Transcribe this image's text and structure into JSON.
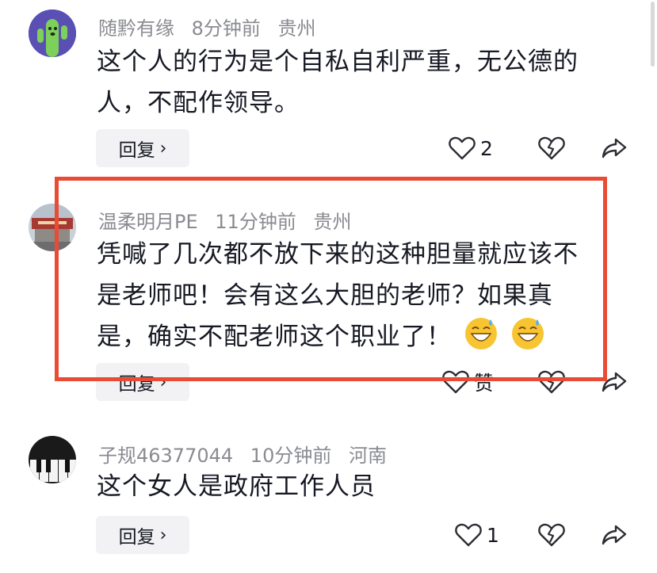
{
  "comments": [
    {
      "username": "随黔有缘",
      "time": "8分钟前",
      "location": "贵州",
      "lines": [
        "这个人的行为是个自私自利严重，无公德的",
        "人，不配作领导。"
      ],
      "reply_label": "回复",
      "like_count": "2"
    },
    {
      "username": "温柔明月PE",
      "time": "11分钟前",
      "location": "贵州",
      "lines": [
        "凭喊了几次都不放下来的这种胆量就应该不",
        "是老师吧！会有这么大胆的老师？如果真",
        "是，确实不配老师这个职业了！"
      ],
      "reply_label": "回复",
      "like_label": "赞"
    },
    {
      "username": "子规46377044",
      "time": "10分钟前",
      "location": "河南",
      "lines": [
        "这个女人是政府工作人员"
      ],
      "reply_label": "回复",
      "like_count": "1"
    }
  ],
  "colors": {
    "highlight": "#e94b35",
    "meta": "#8a8b91",
    "reply_bg": "#f2f2f4"
  }
}
